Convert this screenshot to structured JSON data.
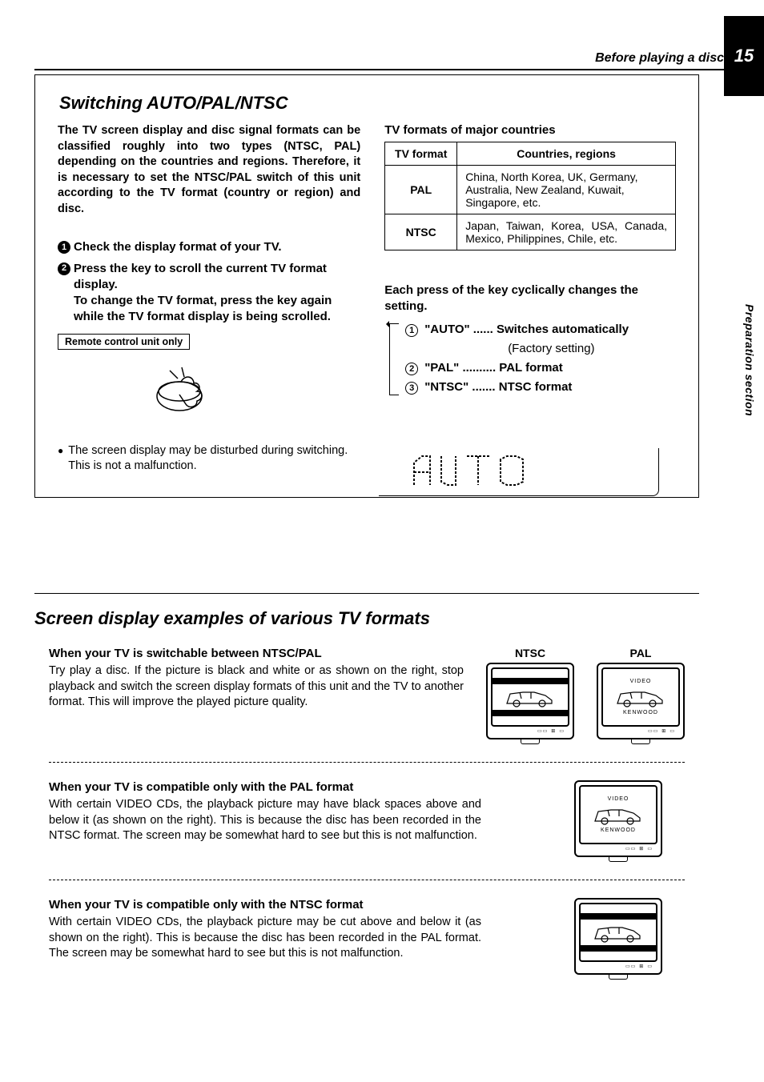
{
  "page_number": "15",
  "header_section": "Before playing a disc",
  "side_label": "Preparation section",
  "section1": {
    "title": "Switching AUTO/PAL/NTSC",
    "intro": "The TV screen display and disc signal formats can be classified roughly into two types (NTSC, PAL) depending on the countries and regions. Therefore, it is necessary to set the NTSC/PAL switch of this unit according to the TV format (country or region) and disc.",
    "step1": "Check the display format of your TV.",
    "step2": "Press the key to scroll the current TV format display.",
    "step2_sub": "To change the TV format, press the key again while the TV format display is being scrolled.",
    "remote_tag": "Remote control unit only",
    "bullet": "The screen display may be disturbed during switching. This is not a malfunction.",
    "right_title": "TV formats of major countries",
    "table": {
      "h1": "TV format",
      "h2": "Countries, regions",
      "r1a": "PAL",
      "r1b": "China, North Korea, UK, Germany, Australia, New Zealand, Kuwait, Singapore, etc.",
      "r2a": "NTSC",
      "r2b": "Japan, Taiwan, Korea, USA, Canada, Mexico, Philippines, Chile, etc."
    },
    "cycle": "Each press of the key cyclically changes the setting.",
    "opt1": "\"AUTO\" ...... Switches automatically",
    "opt1_sub": "(Factory setting)",
    "opt2": "\"PAL\" .......... PAL format",
    "opt3": "\"NTSC\" ....... NTSC format",
    "lcd_text": "AUTO"
  },
  "section2": {
    "title": "Screen display examples of various TV formats",
    "ntsc_label": "NTSC",
    "pal_label": "PAL",
    "video_label": "VIDEO",
    "kenwood_label": "KENWOOD",
    "ex1_h": "When your TV is switchable between NTSC/PAL",
    "ex1_p": "Try play a disc. If the picture is black and white or as shown on the right, stop playback and switch the screen display formats of this unit and the TV to another format. This will improve the played picture quality.",
    "ex2_h": "When your TV is compatible only with the PAL format",
    "ex2_p": "With certain VIDEO CDs, the playback picture may have black spaces above and below it (as shown on the right). This is because the disc has been recorded in the NTSC format. The screen may be somewhat hard to see but this is not malfunction.",
    "ex3_h": "When your TV is compatible only with the NTSC format",
    "ex3_p": "With certain VIDEO CDs, the playback picture may be cut above and below it (as shown on the right). This is because the disc has been recorded in the PAL format. The screen may be somewhat hard to see but this is not malfunction."
  }
}
